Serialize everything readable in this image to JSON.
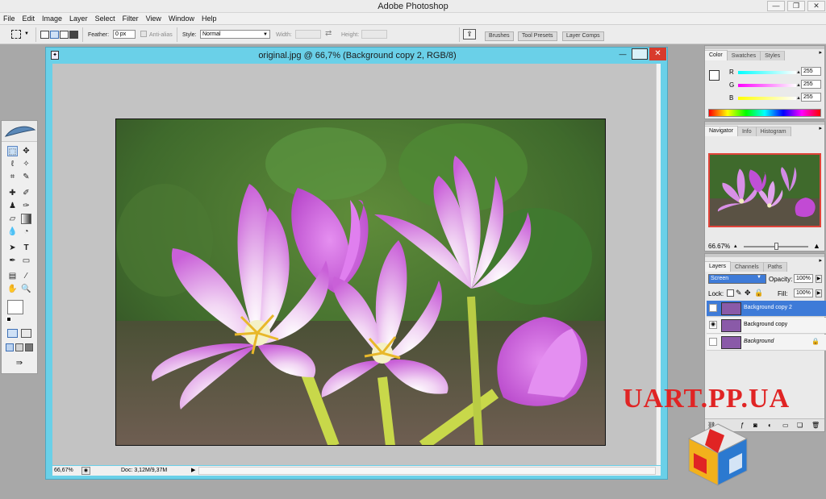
{
  "app": {
    "title": "Adobe Photoshop"
  },
  "window_controls": {
    "minimize": "—",
    "restore": "❐",
    "close": "✕"
  },
  "menu": [
    "File",
    "Edit",
    "Image",
    "Layer",
    "Select",
    "Filter",
    "View",
    "Window",
    "Help"
  ],
  "options": {
    "feather_label": "Feather:",
    "feather_value": "0 px",
    "antialias_label": "Anti-alias",
    "style_label": "Style:",
    "style_value": "Normal",
    "width_label": "Width:",
    "height_label": "Height:"
  },
  "palette_well": [
    "Brushes",
    "Tool Presets",
    "Layer Comps"
  ],
  "document": {
    "title": "original.jpg @ 66,7% (Background copy 2, RGB/8)",
    "zoom": "66,67%",
    "doc_info": "Doc: 3,12M/9,37M"
  },
  "color_panel": {
    "tabs": [
      "Color",
      "Swatches",
      "Styles"
    ],
    "r_label": "R",
    "r_value": "255",
    "g_label": "G",
    "g_value": "255",
    "b_label": "B",
    "b_value": "255"
  },
  "navigator_panel": {
    "tabs": [
      "Navigator",
      "Info",
      "Histogram"
    ],
    "zoom": "66.67%"
  },
  "layers_panel": {
    "tabs": [
      "Layers",
      "Channels",
      "Paths"
    ],
    "blend_mode": "Screen",
    "opacity_label": "Opacity:",
    "opacity_value": "100%",
    "lock_label": "Lock:",
    "fill_label": "Fill:",
    "fill_value": "100%",
    "layers": [
      {
        "name": "Background copy 2",
        "visible": true,
        "selected": true
      },
      {
        "name": "Background copy",
        "visible": true,
        "selected": false
      },
      {
        "name": "Background",
        "visible": false,
        "selected": false
      }
    ]
  },
  "watermark": {
    "text": "UART.PP.UA"
  },
  "colors": {
    "accent": "#3e7bd8",
    "doc_frame": "#6ad0e8",
    "flower": "#d07ae0",
    "watermark": "#e02424"
  }
}
